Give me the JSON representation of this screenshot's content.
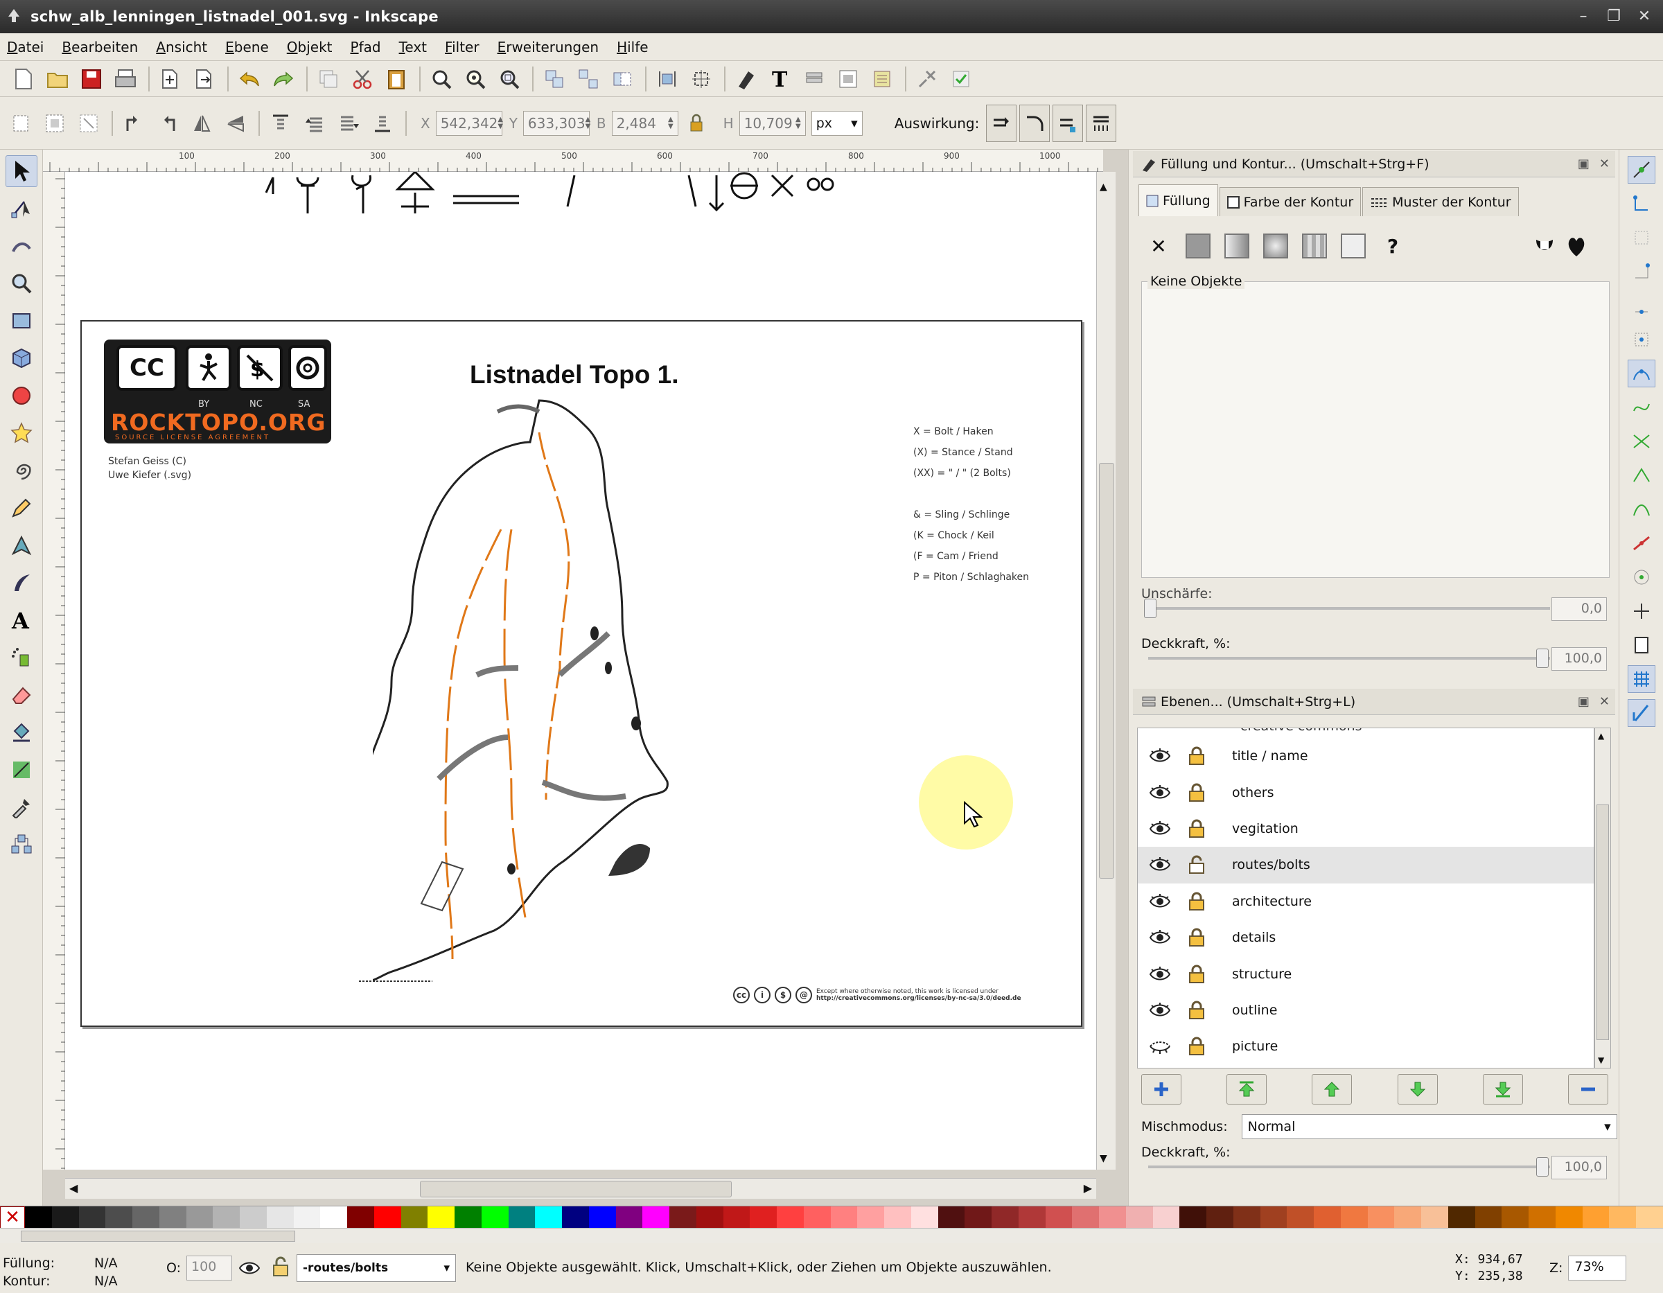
{
  "window": {
    "title": "schw_alb_lenningen_listnadel_001.svg - Inkscape"
  },
  "menu": [
    "Datei",
    "Bearbeiten",
    "Ansicht",
    "Ebene",
    "Objekt",
    "Pfad",
    "Text",
    "Filter",
    "Erweiterungen",
    "Hilfe"
  ],
  "select_toolbar": {
    "x_label": "X",
    "x_value": "542,342",
    "y_label": "Y",
    "y_value": "633,303",
    "w_label": "B",
    "w_value": "2,484",
    "h_label": "H",
    "h_value": "10,709",
    "unit": "px",
    "effect_label": "Auswirkung:"
  },
  "rulers": {
    "top": [
      "100",
      "200",
      "300",
      "400",
      "500",
      "600",
      "700",
      "800",
      "900",
      "1000"
    ]
  },
  "document": {
    "title": "Listnadel Topo 1.",
    "logo": {
      "cc": "CC",
      "by": "BY",
      "nc": "NC",
      "sa": "SA",
      "brand": "ROCKTOPO.ORG",
      "tagline": "SOURCE LICENSE AGREEMENT"
    },
    "authors": [
      "Stefan Geiss (C)",
      "Uwe Kiefer (.svg)"
    ],
    "legend": [
      "X = Bolt / Haken",
      "(X) = Stance / Stand",
      "(XX) = \" / \" (2 Bolts)",
      "",
      "& = Sling / Schlinge",
      "(K = Chock / Keil",
      "(F = Cam / Friend",
      "P = Piton / Schlaghaken"
    ],
    "license_line1": "Except where otherwise noted, this work is licensed under",
    "license_line2": "http://creativecommons.org/licenses/by-nc-sa/3.0/deed.de"
  },
  "fill_stroke": {
    "header": "Füllung und Kontur... (Umschalt+Strg+F)",
    "tabs": [
      "Füllung",
      "Farbe der Kontur",
      "Muster der Kontur"
    ],
    "no_objects": "Keine Objekte",
    "blur_label": "Unschärfe:",
    "blur_value": "0,0",
    "opacity_label": "Deckkraft, %:",
    "opacity_value": "100,0",
    "opacity_fraction": 1.0
  },
  "layers": {
    "header": "Ebenen... (Umschalt+Strg+L)",
    "partial_top": "creative commons",
    "items": [
      {
        "name": "title / name",
        "selected": false,
        "locked": true,
        "visible": true
      },
      {
        "name": "others",
        "selected": false,
        "locked": true,
        "visible": true
      },
      {
        "name": "vegitation",
        "selected": false,
        "locked": true,
        "visible": true
      },
      {
        "name": "routes/bolts",
        "selected": true,
        "locked": false,
        "visible": true
      },
      {
        "name": "architecture",
        "selected": false,
        "locked": true,
        "visible": true
      },
      {
        "name": "details",
        "selected": false,
        "locked": true,
        "visible": true
      },
      {
        "name": "structure",
        "selected": false,
        "locked": true,
        "visible": true
      },
      {
        "name": "outline",
        "selected": false,
        "locked": true,
        "visible": true
      },
      {
        "name": "picture",
        "selected": false,
        "locked": true,
        "visible": false
      }
    ],
    "blend_label": "Mischmodus:",
    "blend_value": "Normal",
    "opacity_label": "Deckkraft, %:",
    "opacity_value": "100,0"
  },
  "palette_colors": [
    "#000000",
    "#1a1a1a",
    "#333333",
    "#4d4d4d",
    "#666666",
    "#808080",
    "#999999",
    "#b3b3b3",
    "#cccccc",
    "#e6e6e6",
    "#f2f2f2",
    "#ffffff",
    "#800000",
    "#ff0000",
    "#808000",
    "#ffff00",
    "#008000",
    "#00ff00",
    "#008080",
    "#00ffff",
    "#000080",
    "#0000ff",
    "#800080",
    "#ff00ff",
    "#7a1a1a",
    "#a01010",
    "#c01818",
    "#e02020",
    "#ff4040",
    "#ff6060",
    "#ff8080",
    "#ffa0a0",
    "#ffc0c0",
    "#ffe0e0",
    "#501010",
    "#701818",
    "#902828",
    "#b03838",
    "#d05050",
    "#e07070",
    "#f09090",
    "#f0b0b0",
    "#f8d0d0",
    "#401008",
    "#602010",
    "#803018",
    "#a04020",
    "#c05028",
    "#e06030",
    "#f07840",
    "#f89060",
    "#f8a878",
    "#f8c098",
    "#502800",
    "#804000",
    "#a85800",
    "#d07000",
    "#f08800",
    "#ffa030",
    "#ffb860",
    "#ffd090"
  ],
  "status": {
    "fill_label": "Füllung:",
    "fill_value": "N/A",
    "stroke_label": "Kontur:",
    "stroke_value": "N/A",
    "opacity_label": "O:",
    "opacity_value": "100",
    "current_layer": "-routes/bolts",
    "message": "Keine Objekte ausgewählt. Klick, Umschalt+Klick, oder Ziehen um Objekte auszuwählen.",
    "x_readout": "X:  934,67",
    "y_readout": "Y:  235,38",
    "zoom_label": "Z:",
    "zoom_value": "73%"
  }
}
